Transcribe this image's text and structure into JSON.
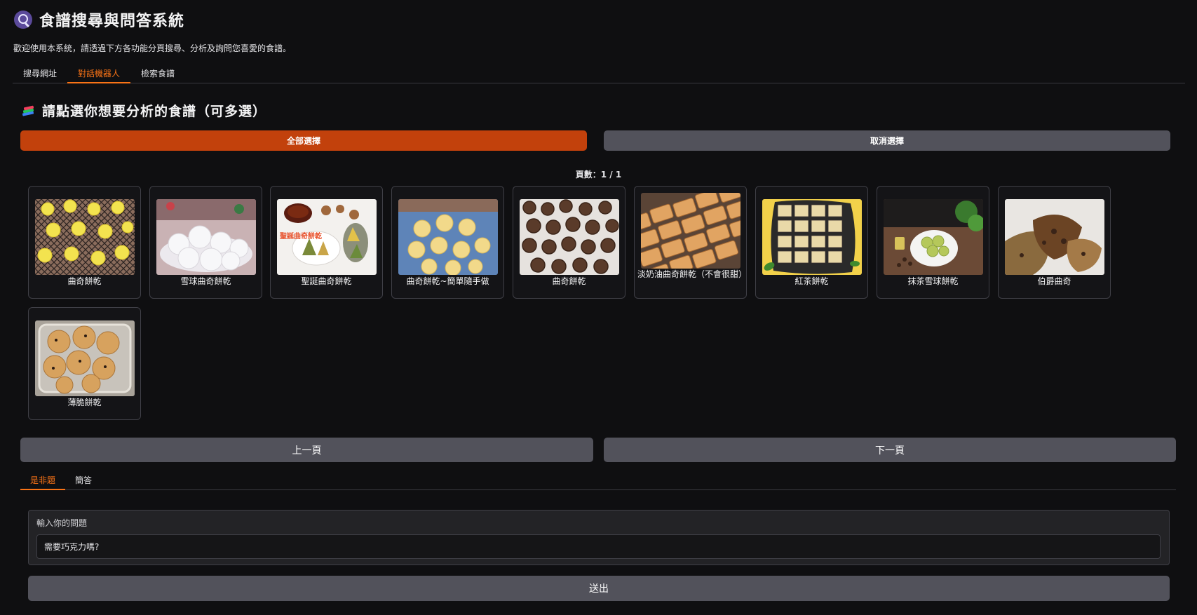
{
  "app": {
    "title": "食譜搜尋與問答系統",
    "subtitle": "歡迎使用本系統，請透過下方各功能分頁搜尋、分析及詢問您喜愛的食譜。",
    "icon": "magnifier-icon"
  },
  "top_tabs": [
    {
      "label": "搜尋網址",
      "active": false
    },
    {
      "label": "對話機器人",
      "active": true
    },
    {
      "label": "檢索食譜",
      "active": false
    }
  ],
  "selection": {
    "title": "請點選你想要分析的食譜（可多選）",
    "icon": "books-icon",
    "select_all_label": "全部選擇",
    "deselect_label": "取消選擇",
    "page_count": "頁數：1 / 1"
  },
  "recipes": [
    {
      "name": "曲奇餅乾"
    },
    {
      "name": "雪球曲奇餅乾"
    },
    {
      "name": "聖誕曲奇餅乾",
      "overlay_text": "聖誕曲奇餅乾"
    },
    {
      "name": "曲奇餅乾~簡單隨手做"
    },
    {
      "name": "曲奇餅乾"
    },
    {
      "name": "淡奶油曲奇餅乾（不會很甜）"
    },
    {
      "name": "紅茶餅乾"
    },
    {
      "name": "抹茶雪球餅乾"
    },
    {
      "name": "伯爵曲奇"
    },
    {
      "name": "薄脆餅乾"
    }
  ],
  "pager": {
    "prev_label": "上一頁",
    "next_label": "下一頁"
  },
  "qa_tabs": [
    {
      "label": "是非題",
      "active": true
    },
    {
      "label": "簡答",
      "active": false
    }
  ],
  "question": {
    "label": "輸入你的問題",
    "value": "需要巧克力嗎?",
    "submit_label": "送出"
  },
  "colors": {
    "accent": "#f97316",
    "primary_button": "#c2410c",
    "secondary_button": "#52525b",
    "background": "#0f0f11"
  }
}
